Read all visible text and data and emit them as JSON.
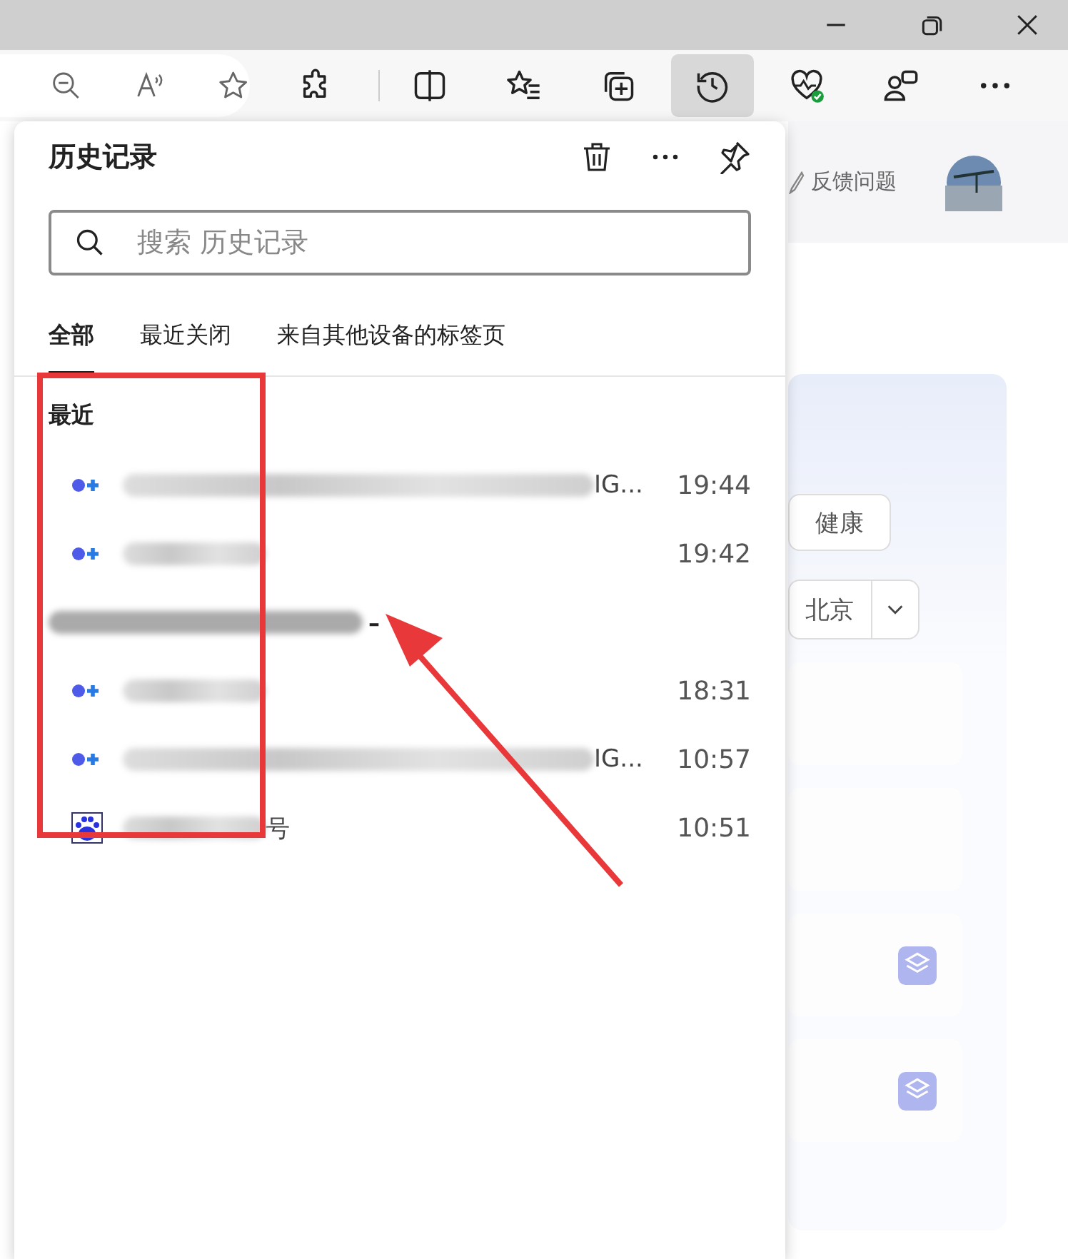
{
  "toolbar": {
    "buttons": [
      {
        "kind": "extensions",
        "selected": false
      },
      {
        "kind": "split",
        "selected": false
      },
      {
        "kind": "favorites",
        "selected": false
      },
      {
        "kind": "collections",
        "selected": false
      },
      {
        "kind": "history",
        "selected": true
      },
      {
        "kind": "health",
        "selected": false
      },
      {
        "kind": "profile",
        "selected": false
      },
      {
        "kind": "more",
        "selected": false
      }
    ]
  },
  "history": {
    "title": "历史记录",
    "search": {
      "placeholder": "搜索 历史记录"
    },
    "tabs": [
      {
        "label": "全部",
        "selected": true
      },
      {
        "label": "最近关闭",
        "selected": false
      },
      {
        "label": "来自其他设备的标签页",
        "selected": false
      }
    ],
    "sections": [
      {
        "heading": "最近",
        "items": [
          {
            "kind": "site",
            "redacted": true,
            "title_tail": "IG...",
            "time": "19:44"
          },
          {
            "kind": "site",
            "redacted": true,
            "time": "19:42"
          }
        ]
      },
      {
        "heading": "–",
        "heading_redacted": true,
        "items": [
          {
            "kind": "site",
            "redacted": true,
            "time": "18:31"
          },
          {
            "kind": "site",
            "redacted": true,
            "title_tail": "IG...",
            "time": "10:57"
          },
          {
            "kind": "paw",
            "redacted": true,
            "title_tail": "号",
            "time": "10:51"
          }
        ]
      }
    ]
  },
  "page": {
    "feedback": "反馈问题",
    "topics": [
      "健康"
    ],
    "city": "北京",
    "cards": [
      {
        "kind": "plain"
      },
      {
        "kind": "plain"
      },
      {
        "kind": "layers"
      },
      {
        "kind": "layers"
      }
    ]
  }
}
